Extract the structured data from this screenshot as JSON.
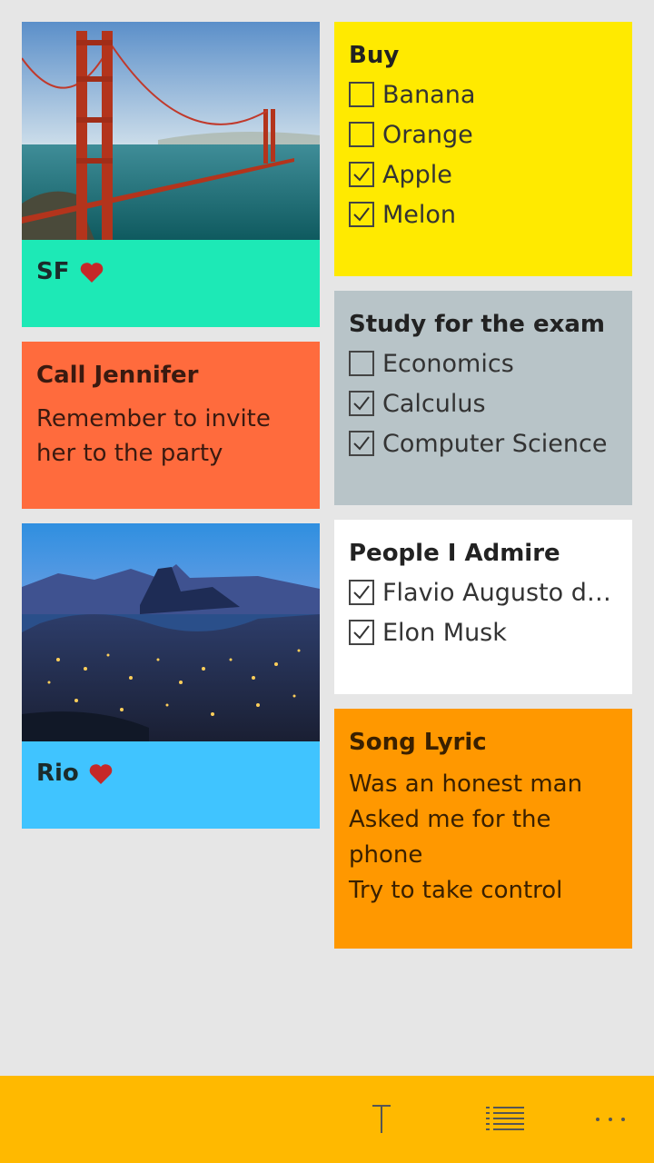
{
  "notes": {
    "sf": {
      "caption": "SF",
      "color": "#1de9b6"
    },
    "call": {
      "title": "Call Jennifer",
      "lines": [
        "Remember to invite",
        "her to the party"
      ],
      "color": "#ff6b3d"
    },
    "rio": {
      "caption": "Rio",
      "color": "#40c4ff"
    },
    "buy": {
      "title": "Buy",
      "color": "#ffea00",
      "items": [
        {
          "label": "Banana",
          "checked": false
        },
        {
          "label": "Orange",
          "checked": false
        },
        {
          "label": "Apple",
          "checked": true
        },
        {
          "label": "Melon",
          "checked": true
        }
      ]
    },
    "study": {
      "title": "Study for the exam",
      "color": "#b8c4c8",
      "items": [
        {
          "label": "Economics",
          "checked": false
        },
        {
          "label": "Calculus",
          "checked": true
        },
        {
          "label": "Computer Science",
          "checked": true
        }
      ]
    },
    "people": {
      "title": "People I Admire",
      "color": "#ffffff",
      "items": [
        {
          "label": "Flavio Augusto da...",
          "checked": true
        },
        {
          "label": "Elon Musk",
          "checked": true
        }
      ]
    },
    "song": {
      "title": "Song Lyric",
      "lines": [
        "Was an honest man",
        "Asked me for the",
        "phone",
        "Try to take control"
      ],
      "color": "#ff9800"
    }
  },
  "appbar": {
    "color": "#ffb900",
    "buttons": [
      "text-note-icon",
      "list-note-icon",
      "more-icon"
    ]
  }
}
